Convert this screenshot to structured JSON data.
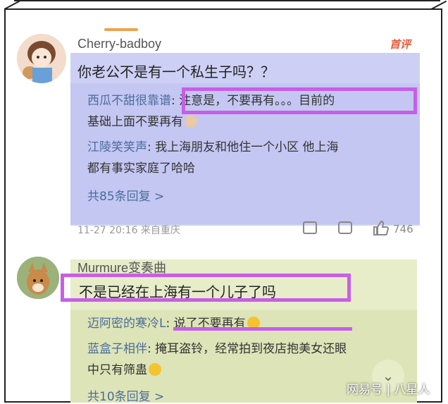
{
  "comment1": {
    "username": "Cherry-badboy",
    "hot_badge": "首评",
    "text": "你老公不是有一个私生子吗？？",
    "replies": [
      {
        "user": "西瓜不甜很靠谱",
        "text_line1": ": 注意是，不要再有。。。目前的",
        "text_line2": "基础上面不要再有"
      },
      {
        "user": "江陵笑笑声",
        "text_line1": ": 我上海朋友和他住一个小区 他上海",
        "text_line2": "都有事实家庭了哈哈"
      }
    ],
    "more_replies": "共85条回复 >",
    "timestamp": "11-27 20:16 来自重庆",
    "like_count": "746"
  },
  "comment2": {
    "username": "Murmure变奏曲",
    "text": "不是已经在上海有一个儿子了吗",
    "replies": [
      {
        "user": "迈阿密的寒冷L",
        "text_line1": ": 说了不要再有"
      },
      {
        "user": "蓝盒子相伴",
        "text_line1": ": 掩耳盗铃，经常拍到夜店抱美女还眼",
        "text_line2": "中只有筛蛊"
      }
    ],
    "more_replies": "共10条回复 >"
  },
  "watermark": "网易号 | 八星人",
  "colors": {
    "highlight": "#c85ee8",
    "link": "#4a6c9c",
    "panel1": "#cdd0f4",
    "panel2": "#e7ecc9"
  }
}
